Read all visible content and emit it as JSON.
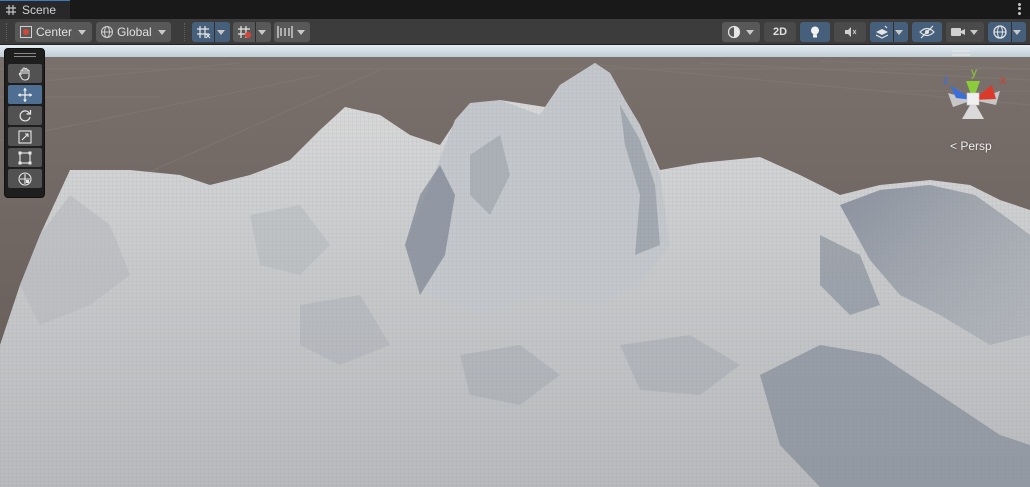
{
  "window": {
    "tab_title": "Scene"
  },
  "toolbar": {
    "pivot_mode": "Center",
    "pivot_rotation": "Global",
    "mode_2d": "2D"
  },
  "viewport": {
    "camera_projection": "Persp",
    "gizmo_axes": {
      "x": "x",
      "y": "y",
      "z": "z"
    }
  },
  "tools": [
    {
      "name": "view-tool",
      "icon": "hand-icon",
      "active": false
    },
    {
      "name": "move-tool",
      "icon": "move-icon",
      "active": true
    },
    {
      "name": "rotate-tool",
      "icon": "rotate-icon",
      "active": false
    },
    {
      "name": "scale-tool",
      "icon": "scale-icon",
      "active": false
    },
    {
      "name": "rect-tool",
      "icon": "rect-icon",
      "active": false
    },
    {
      "name": "transform-tool",
      "icon": "transform-icon",
      "active": false
    }
  ],
  "colors": {
    "accent_blue": "#46607c",
    "tool_active": "#4f6f92",
    "axis_x": "#db3a2a",
    "axis_y": "#8bcc3a",
    "axis_z": "#3a6fdb",
    "sky": "#e6f0f5",
    "ground": "#6b5f5a",
    "terrain": "#c9c9c9"
  }
}
